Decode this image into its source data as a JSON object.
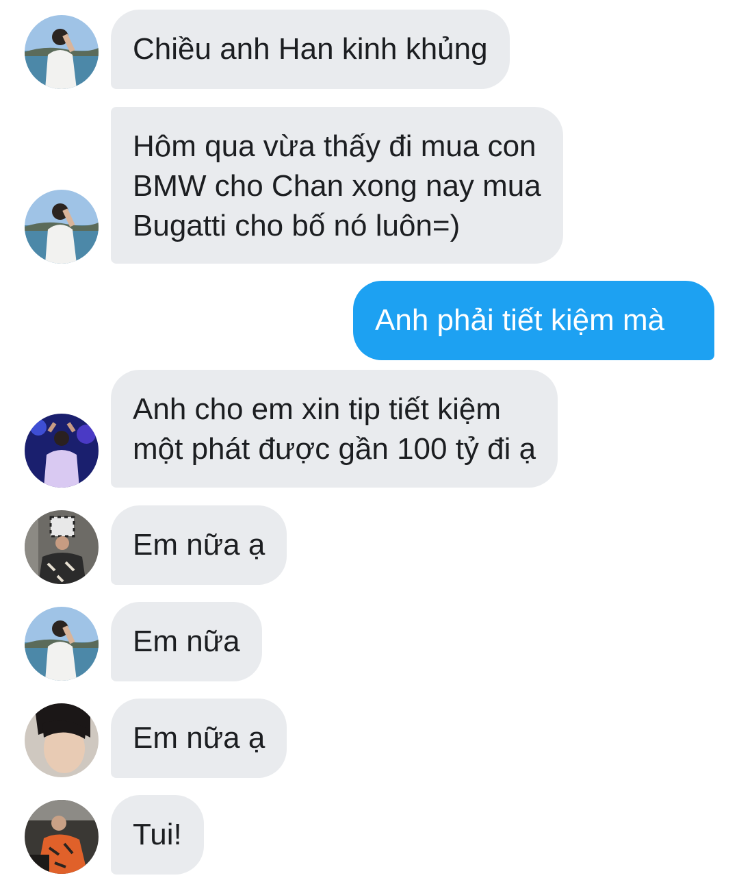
{
  "messages": [
    {
      "sender": "friend_a",
      "direction": "in",
      "text": "Chiều anh Han kinh khủng"
    },
    {
      "sender": "friend_a",
      "direction": "in",
      "text": "Hôm qua vừa thấy đi mua con\nBMW cho Chan xong nay mua\nBugatti cho bố nó luôn=)"
    },
    {
      "sender": "me",
      "direction": "out",
      "text": "Anh phải tiết kiệm mà"
    },
    {
      "sender": "friend_b",
      "direction": "in",
      "text": "Anh cho em xin tip tiết kiệm\nmột phát được gần 100 tỷ đi ạ"
    },
    {
      "sender": "friend_c",
      "direction": "in",
      "text": "Em nữa ạ"
    },
    {
      "sender": "friend_a",
      "direction": "in",
      "text": "Em nữa"
    },
    {
      "sender": "friend_d",
      "direction": "in",
      "text": "Em nữa ạ"
    },
    {
      "sender": "friend_e",
      "direction": "in",
      "text": "Tui!"
    }
  ],
  "colors": {
    "incoming_bubble": "#e9ebee",
    "outgoing_bubble": "#1da1f2",
    "incoming_text": "#1c1e21",
    "outgoing_text": "#ffffff"
  }
}
